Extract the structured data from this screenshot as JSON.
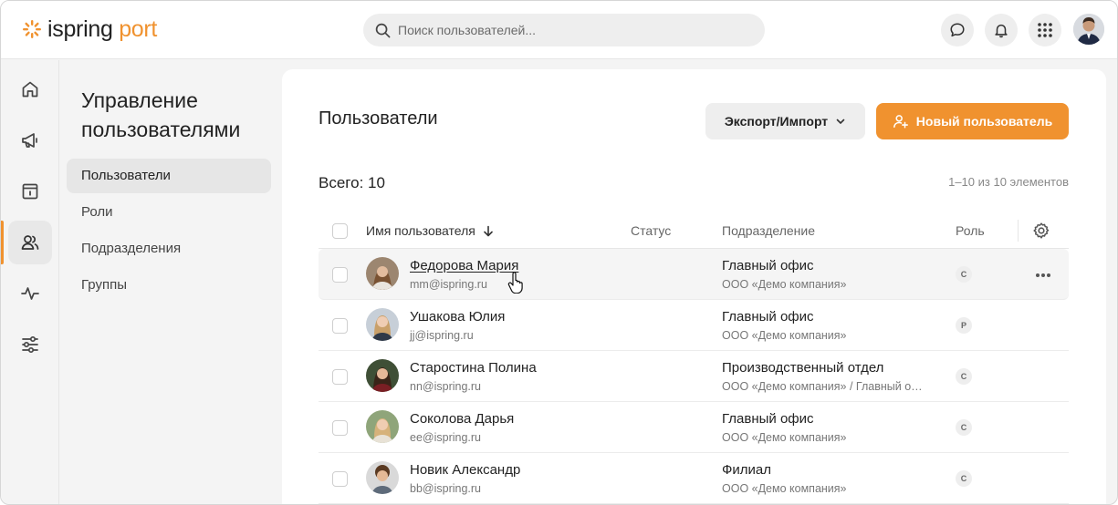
{
  "brand": {
    "name_part1": "ispring",
    "name_part2": "port",
    "accent": "#f0922f"
  },
  "search": {
    "placeholder": "Поиск пользователей..."
  },
  "topbar_icons": [
    "chat-icon",
    "bell-icon",
    "apps-grid-icon"
  ],
  "rail": [
    "home-icon",
    "megaphone-icon",
    "calendar-info-icon",
    "users-icon",
    "activity-icon",
    "sliders-icon"
  ],
  "sidebar": {
    "title": "Управление пользователями",
    "items": [
      {
        "label": "Пользователи",
        "active": true
      },
      {
        "label": "Роли"
      },
      {
        "label": "Подразделения"
      },
      {
        "label": "Группы"
      }
    ]
  },
  "main": {
    "title": "Пользователи",
    "export_label": "Экспорт/Импорт",
    "new_user_label": "Новый пользователь",
    "total_label": "Всего: 10",
    "range_label": "1–10 из 10 элементов",
    "columns": {
      "name": "Имя пользователя",
      "status": "Статус",
      "dept": "Подразделение",
      "role": "Роль"
    },
    "rows": [
      {
        "name": "Федорова Мария",
        "email": "mm@ispring.ru",
        "dept": "Главный офис",
        "org": "ООО «Демо компания»",
        "role": "С"
      },
      {
        "name": "Ушакова Юлия",
        "email": "jj@ispring.ru",
        "dept": "Главный офис",
        "org": "ООО «Демо компания»",
        "role": "Р"
      },
      {
        "name": "Старостина Полина",
        "email": "nn@ispring.ru",
        "dept": "Производственный отдел",
        "org": "ООО «Демо компания» / Главный о…",
        "role": "С"
      },
      {
        "name": "Соколова Дарья",
        "email": "ee@ispring.ru",
        "dept": "Главный офис",
        "org": "ООО «Демо компания»",
        "role": "С"
      },
      {
        "name": "Новик Александр",
        "email": "bb@ispring.ru",
        "dept": "Филиал",
        "org": "ООО «Демо компания»",
        "role": "С"
      }
    ]
  }
}
